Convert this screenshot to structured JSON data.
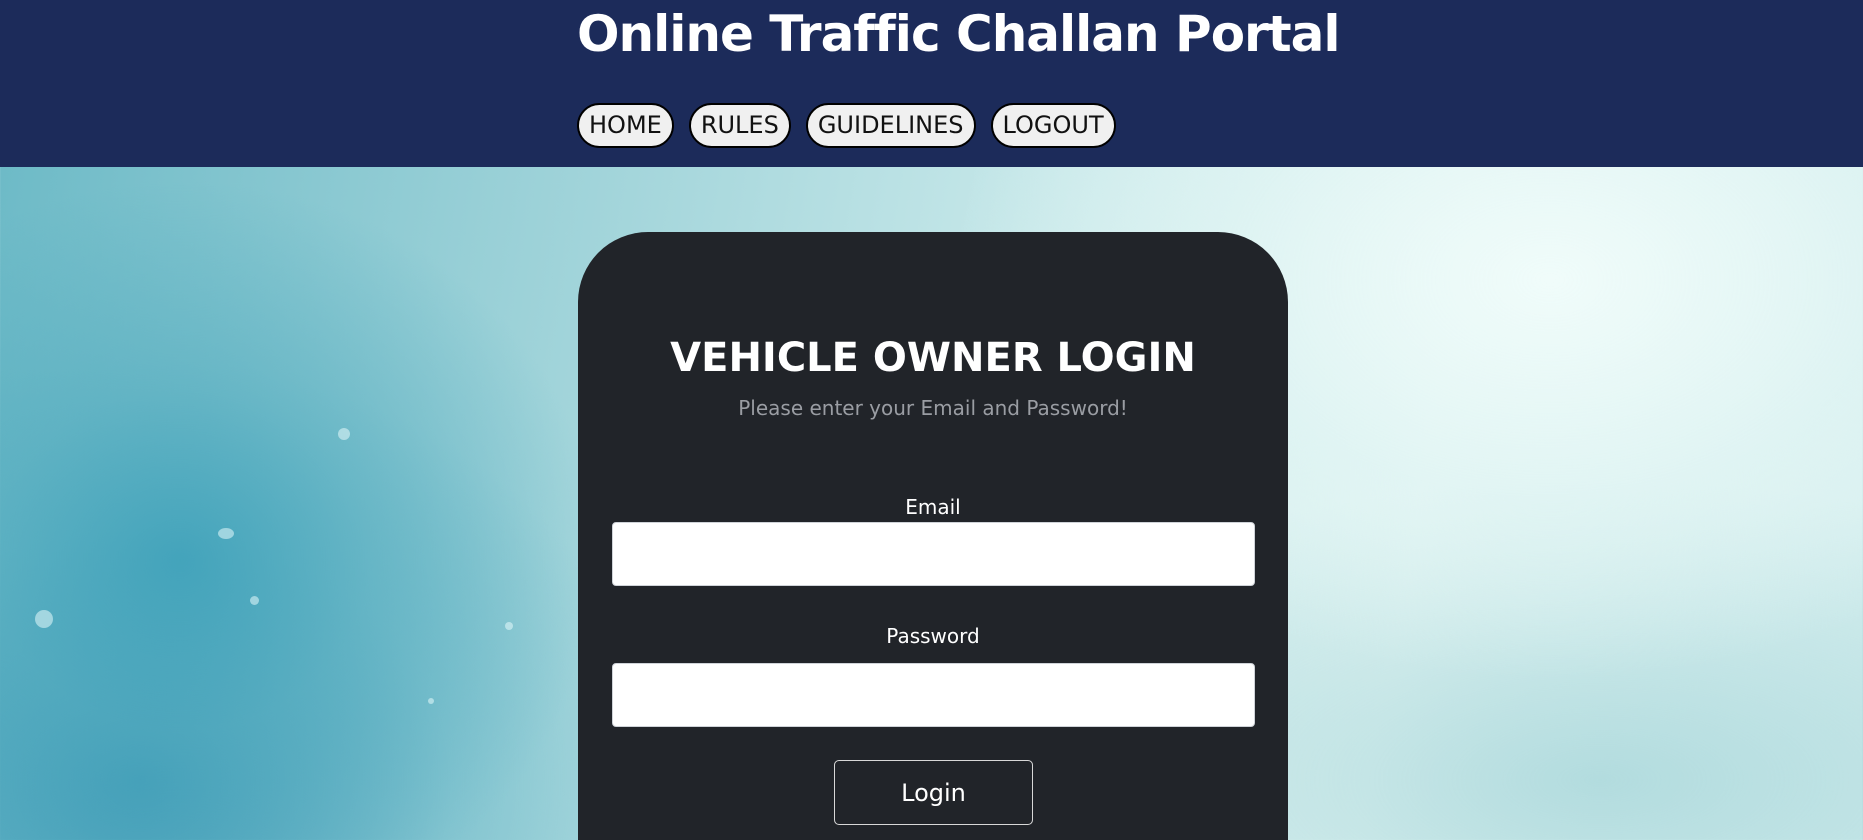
{
  "header": {
    "title": "Online Traffic Challan Portal",
    "nav": [
      {
        "label": "HOME"
      },
      {
        "label": "RULES"
      },
      {
        "label": "GUIDELINES"
      },
      {
        "label": "LOGOUT"
      }
    ]
  },
  "login": {
    "title": "VEHICLE OWNER LOGIN",
    "subtitle": "Please enter your Email and Password!",
    "email": {
      "label": "Email",
      "value": "",
      "placeholder": ""
    },
    "password": {
      "label": "Password",
      "value": "",
      "placeholder": ""
    },
    "submit_label": "Login"
  },
  "colors": {
    "header_bg": "#1c2b5a",
    "card_bg": "#212429",
    "nav_button_bg": "#f0f0f0",
    "subtitle_text": "#9a9da3"
  }
}
